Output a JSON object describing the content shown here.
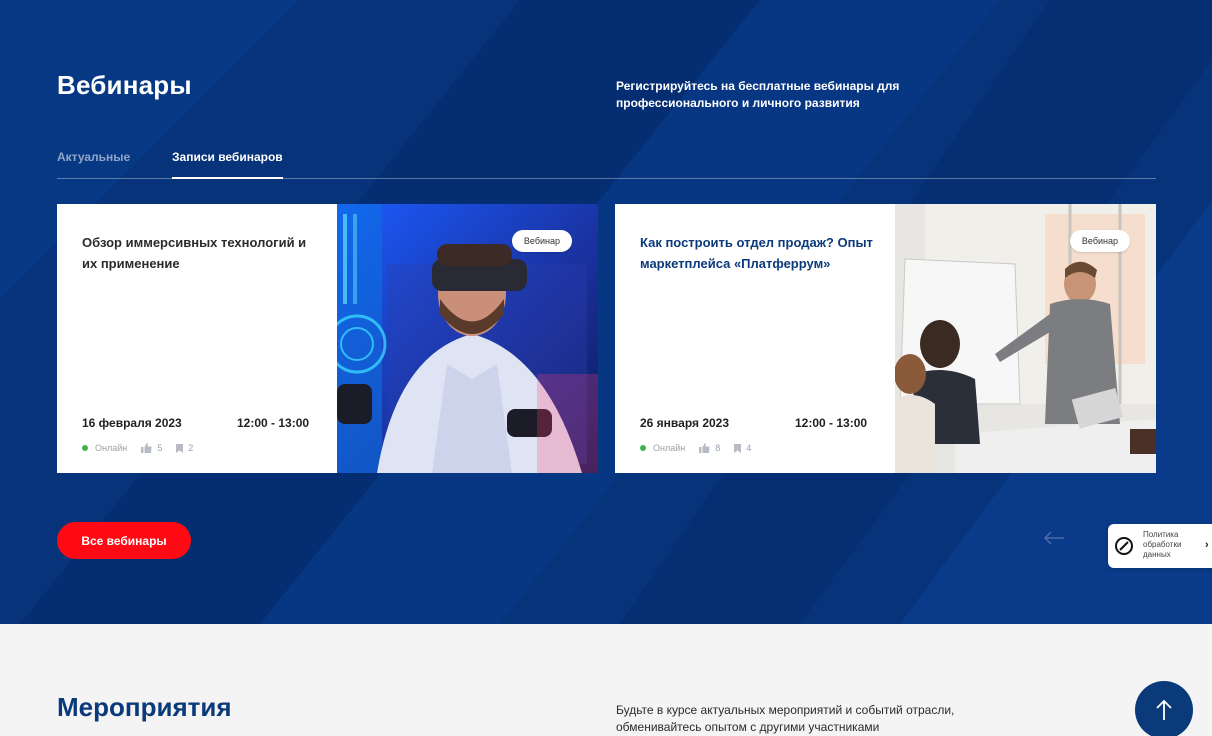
{
  "webinars": {
    "title": "Вебинары",
    "subtitle": "Регистрируйтесь на бесплатные вебинары для профессионального и личного развития",
    "tabs": [
      {
        "label": "Актуальные",
        "active": false
      },
      {
        "label": "Записи вебинаров",
        "active": true
      }
    ],
    "cards": [
      {
        "title": "Обзор иммерсивных технологий и их применение",
        "badge": "Вебинар",
        "date": "16 февраля 2023",
        "time": "12:00 - 13:00",
        "mode": "Онлайн",
        "likes": "5",
        "bookmarks": "2"
      },
      {
        "title": "Как построить отдел продаж? Опыт маркетплейса «Платферрум»",
        "badge": "Вебинар",
        "date": "26 января 2023",
        "time": "12:00 - 13:00",
        "mode": "Онлайн",
        "likes": "8",
        "bookmarks": "4"
      }
    ],
    "all_button": "Все вебинары"
  },
  "policy": {
    "line1": "Политика",
    "line2": "обработки",
    "line3": "данных"
  },
  "events": {
    "title": "Мероприятия",
    "subtitle": "Будьте в курсе актуальных мероприятий и событий отрасли, обменивайтесь опытом с другими участниками"
  },
  "colors": {
    "hero_bg": "#06337a",
    "accent_red": "#ff0a14",
    "brand_blue": "#0b3a7a",
    "online_green": "#3cb44a"
  }
}
